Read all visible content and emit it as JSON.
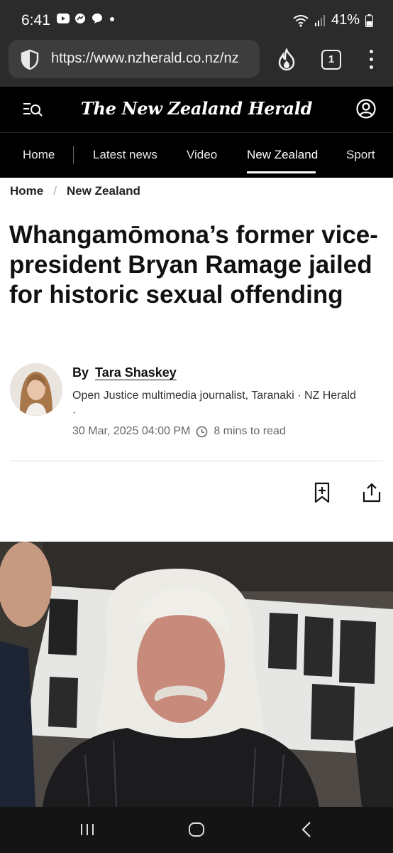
{
  "status_bar": {
    "time": "6:41",
    "battery": "41%",
    "icons": [
      "youtube-icon",
      "messenger-icon",
      "chat-icon",
      "dot-icon",
      "wifi-icon",
      "signal-icon",
      "battery-icon"
    ]
  },
  "browser": {
    "url": "https://www.nzherald.co.nz/nz",
    "tab_count": "1"
  },
  "site": {
    "logo": "The New Zealand Herald"
  },
  "nav": {
    "items": [
      {
        "label": "Home"
      },
      {
        "label": "Latest news"
      },
      {
        "label": "Video"
      },
      {
        "label": "New Zealand",
        "active": true
      },
      {
        "label": "Sport"
      }
    ]
  },
  "breadcrumb": {
    "home": "Home",
    "separator": "/",
    "section": "New Zealand"
  },
  "article": {
    "headline": "Whangamōmona’s former vice-president Bryan Ramage jailed for historic sexual offending",
    "by_label": "By",
    "author": "Tara Shaskey",
    "role": "Open Justice multimedia journalist, Taranaki · NZ Herald ·",
    "date": "30 Mar, 2025 04:00 PM",
    "read_time": "8 mins to read"
  },
  "colors": {
    "header_bg": "#000000",
    "status_bg": "#2b2b2b",
    "text": "#111111"
  }
}
